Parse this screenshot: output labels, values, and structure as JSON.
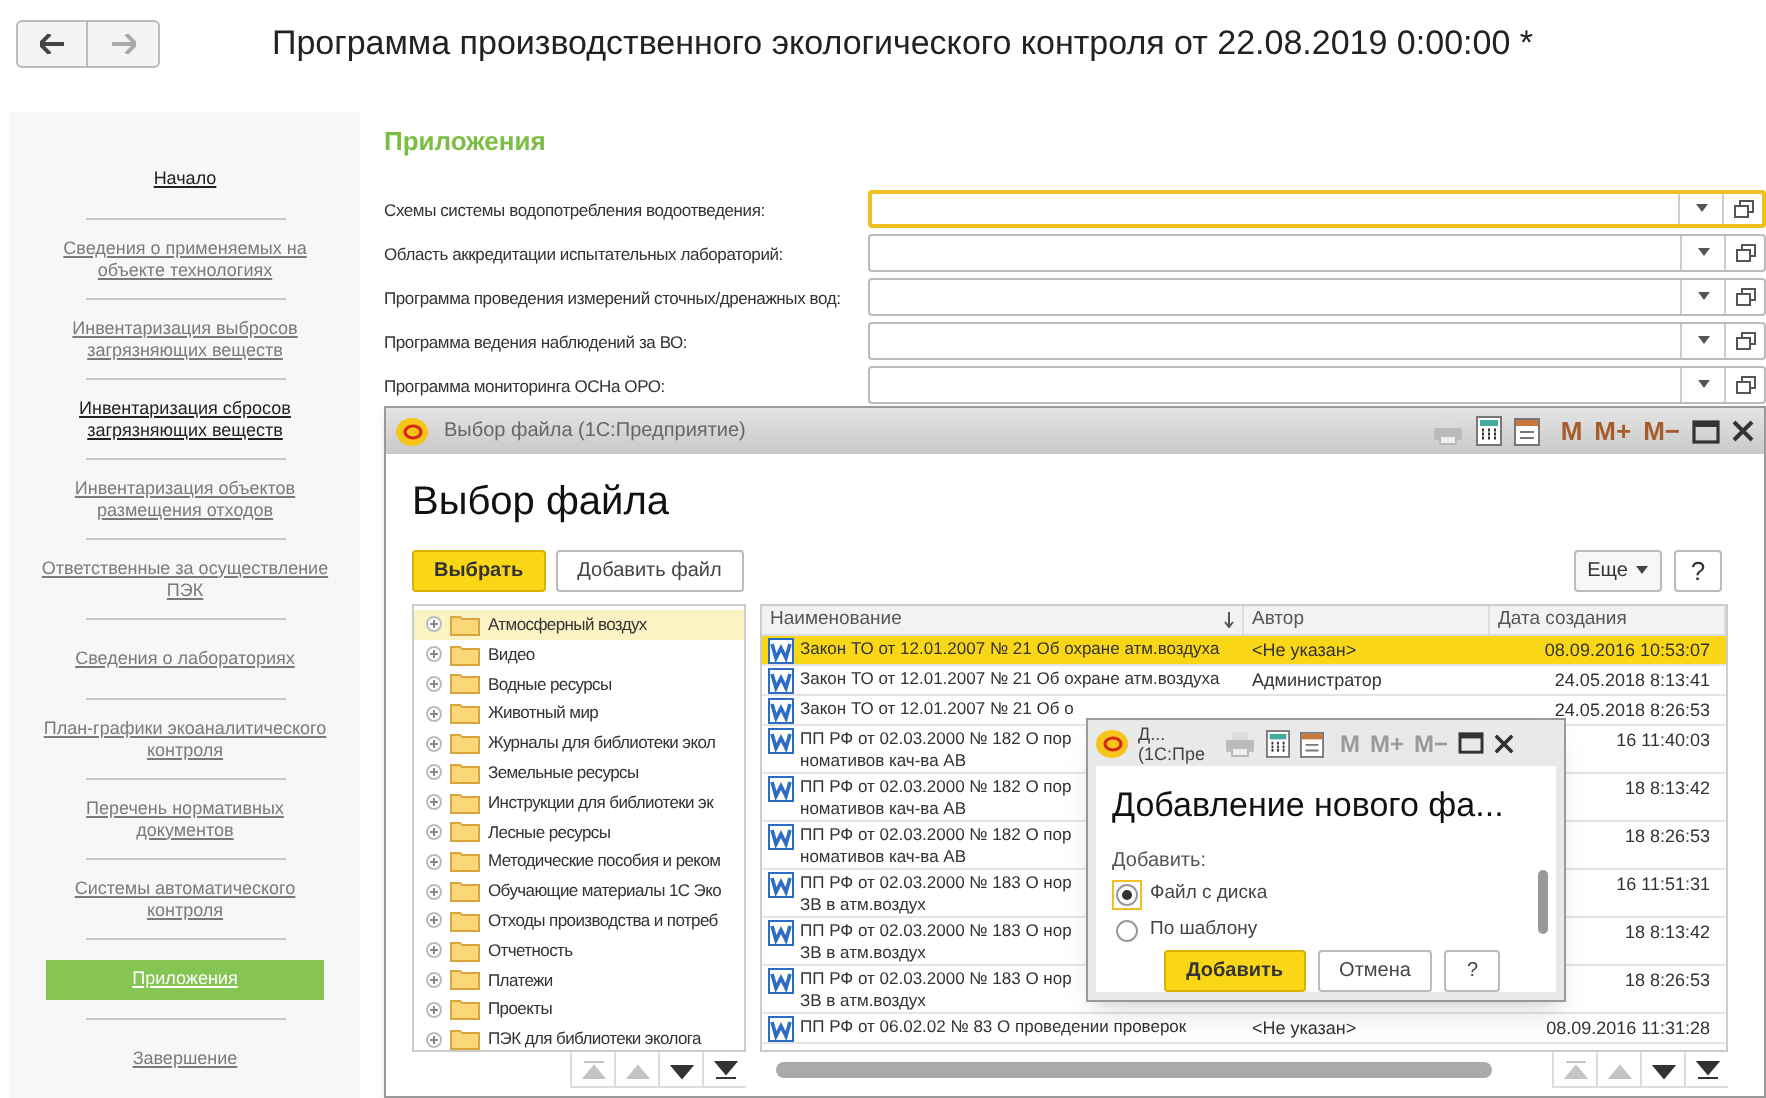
{
  "header": {
    "title": "Программа производственного экологического контроля  от 22.08.2019 0:00:00 *"
  },
  "sidebar": {
    "items": [
      {
        "label": "Начало",
        "visited": false,
        "selected": false
      },
      {
        "label": "Сведения о применяемых на объекте технологиях",
        "visited": true,
        "selected": false
      },
      {
        "label": "Инвентаризация выбросов загрязняющих веществ",
        "visited": true,
        "selected": false
      },
      {
        "label": "Инвентаризация сбросов загрязняющих веществ",
        "visited": false,
        "selected": false
      },
      {
        "label": "Инвентаризация объектов размещения отходов",
        "visited": true,
        "selected": false
      },
      {
        "label": "Ответственные за осуществление ПЭК",
        "visited": true,
        "selected": false
      },
      {
        "label": "Сведения о лабораториях",
        "visited": true,
        "selected": false
      },
      {
        "label": "План-графики экоаналитического контроля",
        "visited": true,
        "selected": false
      },
      {
        "label": "Перечень нормативных документов",
        "visited": true,
        "selected": false
      },
      {
        "label": "Системы автоматического контроля",
        "visited": true,
        "selected": false
      },
      {
        "label": "Приложения",
        "visited": true,
        "selected": true
      },
      {
        "label": "Завершение",
        "visited": true,
        "selected": false
      }
    ]
  },
  "section": {
    "title": "Приложения",
    "fields": [
      {
        "label": "Схемы системы водопотребления водоотведения:",
        "focused": true
      },
      {
        "label": "Область аккредитации испытательных лабораторий:",
        "focused": false
      },
      {
        "label": "Программа проведения измерений сточных/дренажных вод:",
        "focused": false
      },
      {
        "label": "Программа ведения наблюдений за ВО:",
        "focused": false
      },
      {
        "label": "Программа мониторинга ОСНа ОРО:",
        "focused": false
      }
    ]
  },
  "file_dialog": {
    "title": "Выбор файла  (1С:Предприятие)",
    "memory_buttons": [
      {
        "label": "M",
        "disabled": false
      },
      {
        "label": "M+",
        "disabled": false
      },
      {
        "label": "M−",
        "disabled": false
      }
    ],
    "heading": "Выбор файла",
    "buttons": [
      {
        "label": "Выбрать",
        "kind": "default"
      },
      {
        "label": "Добавить файл",
        "kind": "normal"
      }
    ],
    "more_button": "Еще",
    "help_button": "?",
    "folders": [
      {
        "label": "Атмосферный воздух",
        "selected": true,
        "expanded": false
      },
      {
        "label": "Видео",
        "selected": false,
        "expanded": false
      },
      {
        "label": "Водные ресурсы",
        "selected": false,
        "expanded": false
      },
      {
        "label": "Животный мир",
        "selected": false,
        "expanded": false
      },
      {
        "label": "Журналы для библиотеки экол",
        "selected": false,
        "expanded": false
      },
      {
        "label": "Земельные ресурсы",
        "selected": false,
        "expanded": false
      },
      {
        "label": "Инструкции для библиотеки эк",
        "selected": false,
        "expanded": false
      },
      {
        "label": "Лесные ресурсы",
        "selected": false,
        "expanded": false
      },
      {
        "label": "Методические пособия и реком",
        "selected": false,
        "expanded": false
      },
      {
        "label": "Обучающие материалы 1С Эко",
        "selected": false,
        "expanded": false
      },
      {
        "label": "Отходы производства и потреб",
        "selected": false,
        "expanded": false
      },
      {
        "label": "Отчетность",
        "selected": false,
        "expanded": false
      },
      {
        "label": "Платежи",
        "selected": false,
        "expanded": false
      },
      {
        "label": "Проекты",
        "selected": false,
        "expanded": false
      },
      {
        "label": "ПЭК для библиотеки эколога",
        "selected": false,
        "expanded": false
      }
    ],
    "nav_buttons": [
      {
        "kind": "first",
        "disabled": true
      },
      {
        "kind": "up",
        "disabled": true
      },
      {
        "kind": "down",
        "disabled": false
      },
      {
        "kind": "last",
        "disabled": false
      }
    ],
    "table": {
      "columns": [
        "Наименование",
        "Автор",
        "Дата создания"
      ],
      "rows": [
        {
          "name": [
            "Закон ТО от 12.01.2007 № 21 Об охране атм.воздуха"
          ],
          "author": "<Не указан>",
          "date": "08.09.2016 10:53:07",
          "selected": true
        },
        {
          "name": [
            "Закон ТО от 12.01.2007 № 21 Об охране атм.воздуха"
          ],
          "author": "Администратор",
          "date": "24.05.2018 8:13:41",
          "selected": false
        },
        {
          "name": [
            "Закон ТО от 12.01.2007 № 21 Об о"
          ],
          "date": "24.05.2018 8:26:53",
          "selected": false
        },
        {
          "name": [
            "ПП РФ от 02.03.2000 № 182 О пор",
            "номативов кач-ва АВ"
          ],
          "date": "16 11:40:03",
          "selected": false
        },
        {
          "name": [
            "ПП РФ от 02.03.2000 № 182 О пор",
            "номативов кач-ва АВ"
          ],
          "date": "18 8:13:42",
          "selected": false
        },
        {
          "name": [
            "ПП РФ от 02.03.2000 № 182 О пор",
            "номативов кач-ва АВ"
          ],
          "date": "18 8:26:53",
          "selected": false
        },
        {
          "name": [
            "ПП РФ от 02.03.2000 № 183 О нор",
            "ЗВ в атм.воздух"
          ],
          "date": "16 11:51:31",
          "selected": false
        },
        {
          "name": [
            "ПП РФ от 02.03.2000 № 183 О нор",
            "ЗВ в атм.воздух"
          ],
          "date": "18 8:13:42",
          "selected": false
        },
        {
          "name": [
            "ПП РФ от 02.03.2000 № 183 О нор",
            "ЗВ в атм.воздух"
          ],
          "date": "18 8:26:53",
          "selected": false
        },
        {
          "name": [
            "ПП РФ от 06.02.02 № 83 О проведении проверок"
          ],
          "author": "<Не указан>",
          "date": "08.09.2016 11:31:28",
          "selected": false
        }
      ],
      "nav_buttons": [
        {
          "kind": "first",
          "disabled": true
        },
        {
          "kind": "up",
          "disabled": true
        },
        {
          "kind": "down",
          "disabled": false
        },
        {
          "kind": "last",
          "disabled": false
        }
      ]
    }
  },
  "add_dialog": {
    "title": [
      "Д...",
      "(1С:Пре"
    ],
    "memory_buttons": [
      {
        "label": "M",
        "disabled": true
      },
      {
        "label": "M+",
        "disabled": true
      },
      {
        "label": "M−",
        "disabled": true
      }
    ],
    "heading": "Добавление нового фа...",
    "group_label": "Добавить:",
    "options": [
      {
        "label": "Файл с диска",
        "selected": true
      },
      {
        "label": "По шаблону",
        "selected": false
      }
    ],
    "buttons": [
      {
        "label": "Добавить",
        "kind": "default"
      },
      {
        "label": "Отмена",
        "kind": "normal"
      },
      {
        "label": "?",
        "kind": "normal"
      }
    ]
  }
}
